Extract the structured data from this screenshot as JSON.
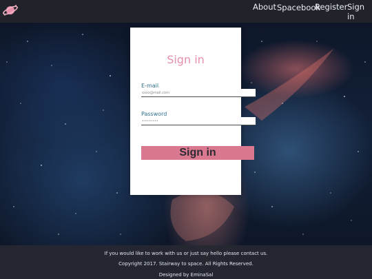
{
  "nav": {
    "about": "About",
    "spacebook": "Spacebook",
    "register": "Register",
    "signin": "Sign in"
  },
  "logo": {
    "icon": "planet-icon",
    "color": "#e890ab"
  },
  "form": {
    "title": "Sign in",
    "email_label": "E-mail",
    "email_placeholder": "xxxx@mail.com",
    "password_label": "Password",
    "password_placeholder": "••••••••",
    "submit_label": "Sign in"
  },
  "colors": {
    "accent": "#e890ab",
    "button": "#d9788f",
    "label": "#2c6e8a"
  },
  "footer": {
    "line1": "If you would like to work with us or just say hello please contact us.",
    "line2": "Copyright 2017. Stairway to space. All Rights Reserved.",
    "line3": "Designed by EminaSal"
  }
}
